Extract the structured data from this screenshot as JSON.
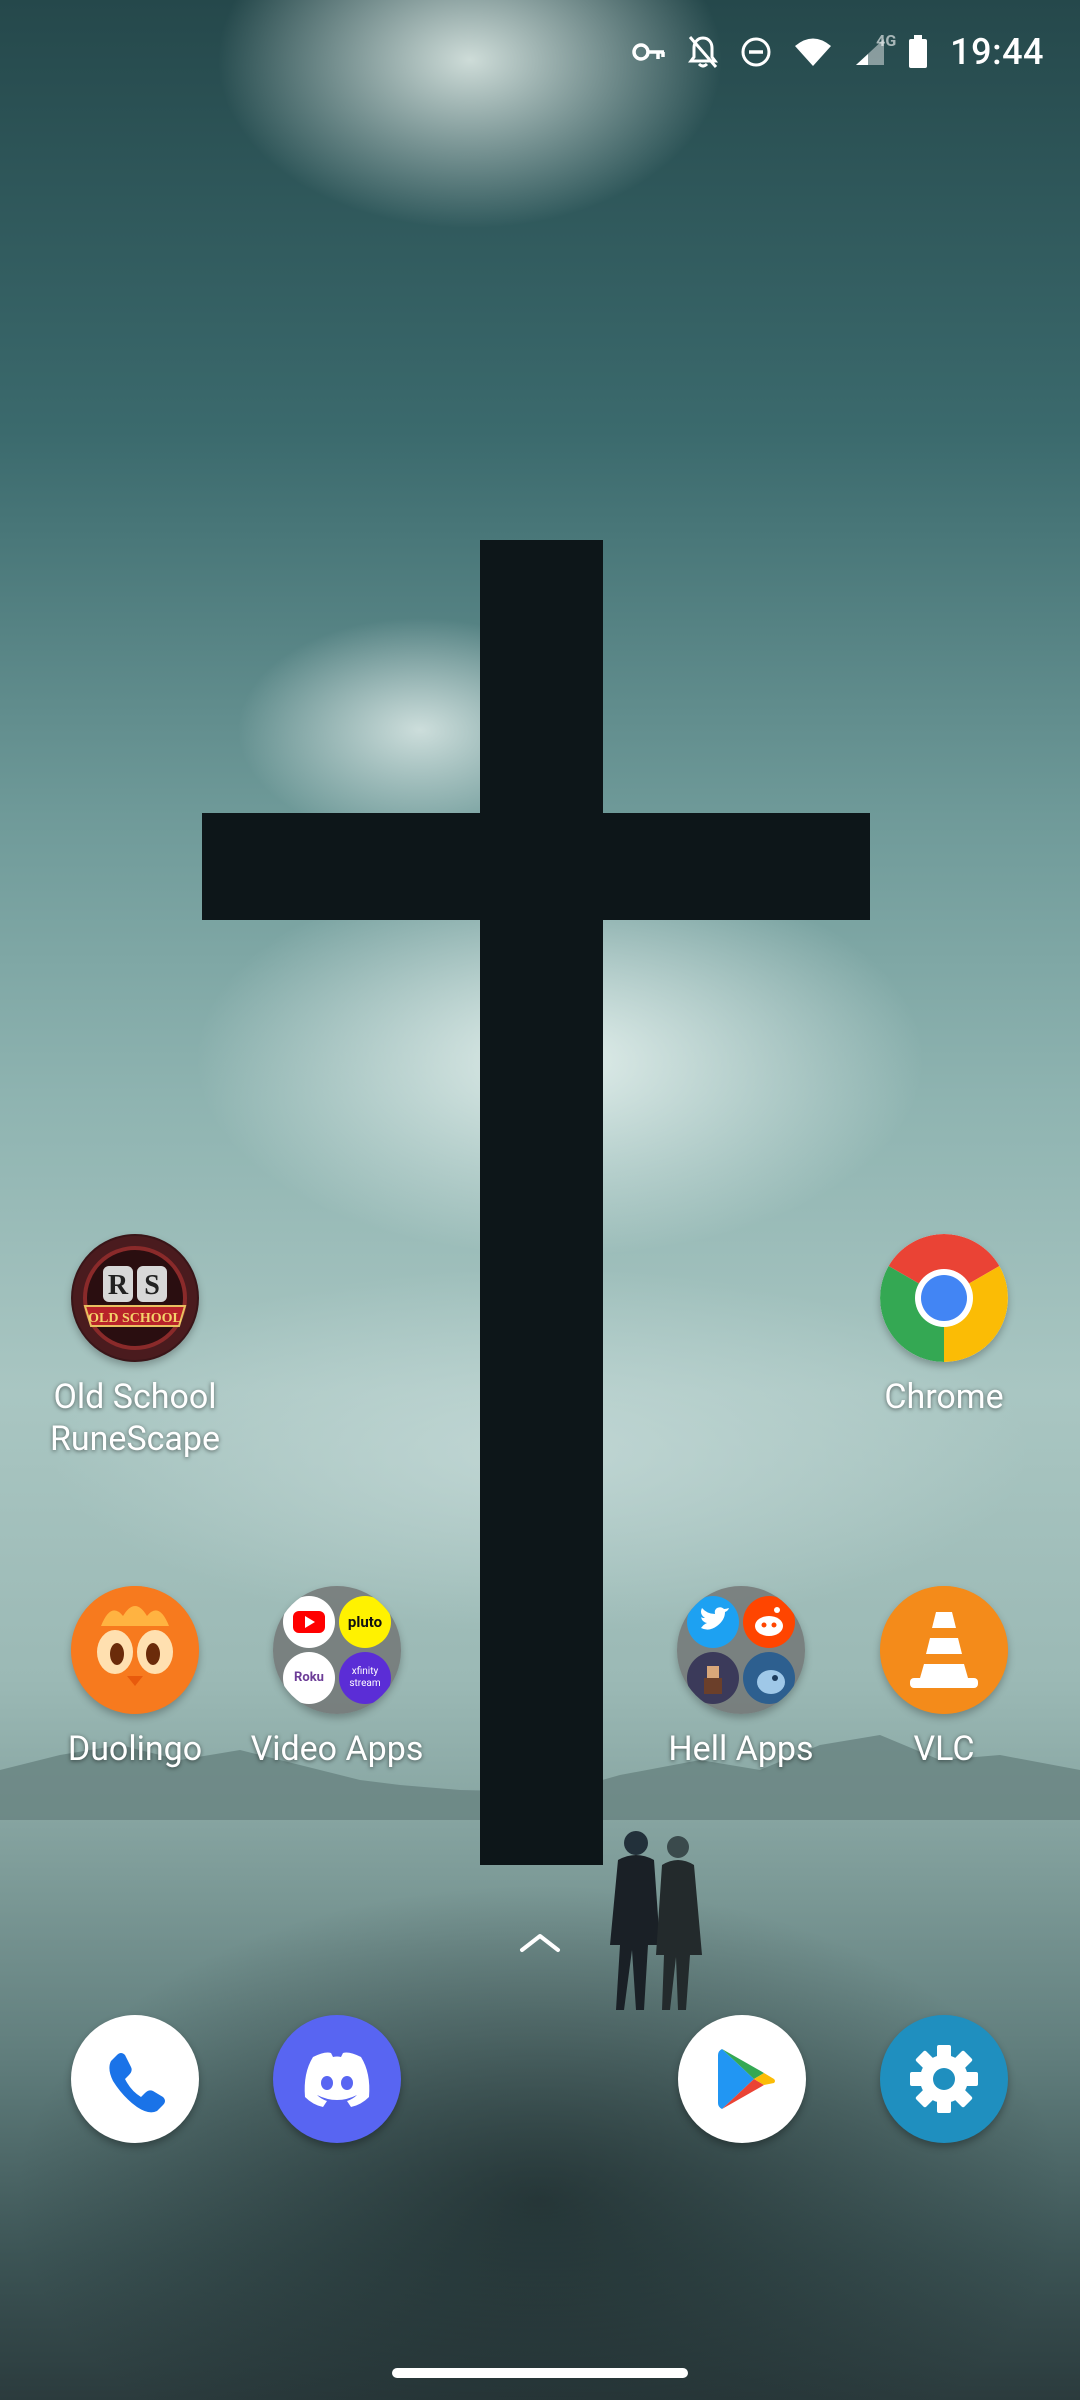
{
  "status_bar": {
    "time": "19:44",
    "network": "4G",
    "icons": [
      "vpn-key-icon",
      "notifications-off-icon",
      "do-not-disturb-icon",
      "wifi-icon",
      "cell-signal-icon",
      "battery-icon"
    ]
  },
  "home": {
    "apps": [
      {
        "id": "osrs",
        "label": "Old School\nRuneScape",
        "icon": "old-school-runescape-icon",
        "icon_text": "RS",
        "banner_text": "OLD SCHOOL"
      },
      {
        "id": "chrome",
        "label": "Chrome",
        "icon": "chrome-icon"
      },
      {
        "id": "duolingo",
        "label": "Duolingo",
        "icon": "duolingo-icon"
      },
      {
        "id": "video_apps",
        "label": "Video Apps",
        "icon": "folder-icon",
        "mini_icons": [
          {
            "name": "youtube-icon"
          },
          {
            "name": "pluto-tv-icon",
            "text": "pluto"
          },
          {
            "name": "roku-icon",
            "text": "Roku"
          },
          {
            "name": "xfinity-stream-icon",
            "text": "xfinity stream"
          }
        ]
      },
      {
        "id": "hell_apps",
        "label": "Hell Apps",
        "icon": "folder-icon",
        "mini_icons": [
          {
            "name": "twitter-icon"
          },
          {
            "name": "reddit-icon"
          },
          {
            "name": "game-character-icon"
          },
          {
            "name": "blue-creature-icon"
          }
        ]
      },
      {
        "id": "vlc",
        "label": "VLC",
        "icon": "vlc-icon"
      }
    ]
  },
  "dock": [
    {
      "id": "phone",
      "icon": "phone-icon"
    },
    {
      "id": "discord",
      "icon": "discord-icon"
    },
    {
      "id": "play_store",
      "icon": "play-store-icon"
    },
    {
      "id": "settings",
      "icon": "settings-gear-icon"
    }
  ],
  "colors": {
    "discord": "#5865F2",
    "settings": "#1F8FBF",
    "duolingo": "#F77A1E",
    "vlc": "#F48B1A",
    "chrome_red": "#EA4335",
    "chrome_green": "#34A853",
    "chrome_yellow": "#FBBC05",
    "chrome_blue": "#4285F4"
  }
}
